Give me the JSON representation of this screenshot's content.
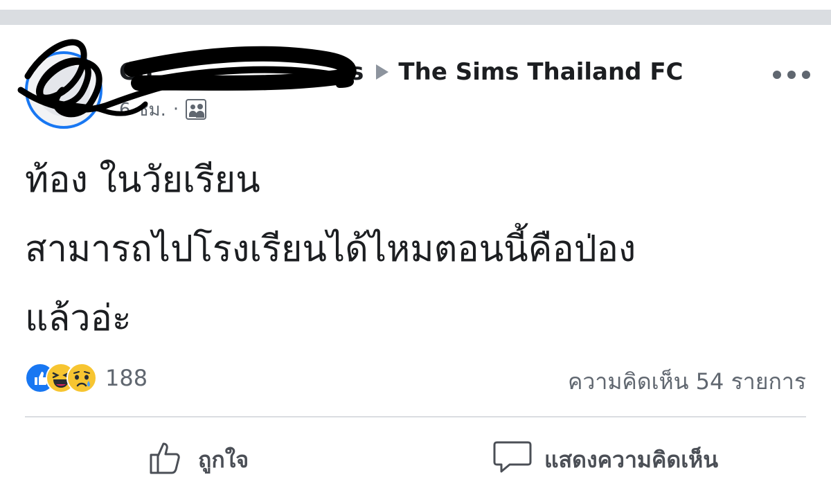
{
  "post": {
    "author": "Ch",
    "author_suffix": "s",
    "group": "The Sims Thailand FC",
    "time": "6 ชม.",
    "separator": "·",
    "text_lines": [
      "ท้อง ในวัยเรียน",
      "สามารถไปโรงเรียนได้ไหมตอนนี้คือป่อง",
      "แล้วอ่ะ"
    ]
  },
  "reactions": {
    "count": "188",
    "icons": [
      "like-icon",
      "haha-icon",
      "sad-icon"
    ]
  },
  "comments": {
    "label": "ความคิดเห็น 54 รายการ"
  },
  "actions": {
    "like_label": "ถูกใจ",
    "comment_label": "แสดงความคิดเห็น"
  },
  "colors": {
    "accent": "#1877f2",
    "text": "#1c1e21",
    "secondary_text": "#606770",
    "divider": "#dadde1"
  }
}
